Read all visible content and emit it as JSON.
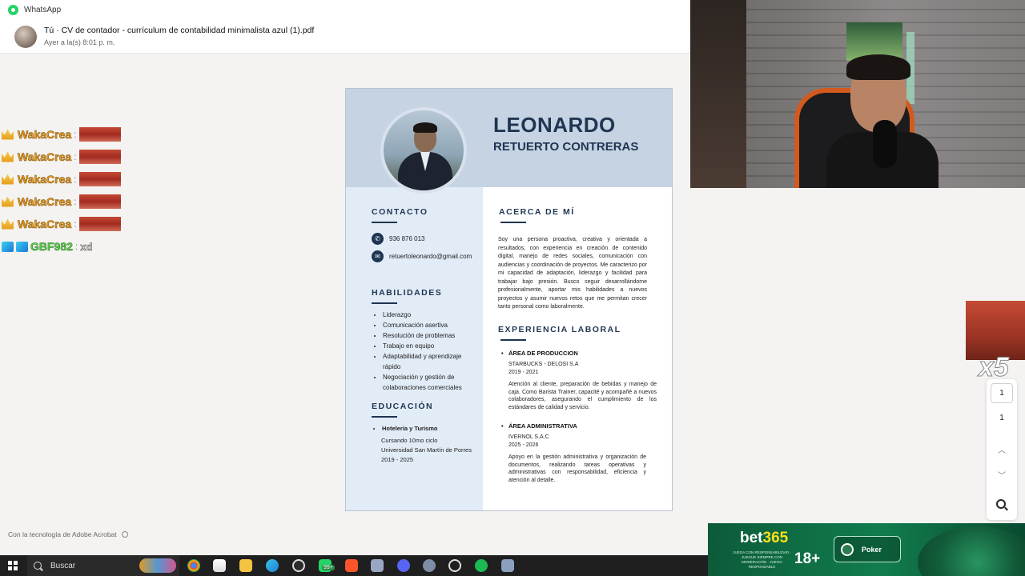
{
  "whatsapp": {
    "app_name": "WhatsApp",
    "file_title": "Tú · CV de contador - currículum de contabilidad minimalista azul (1).pdf",
    "file_time": "Ayer a la(s) 8:01 p. m."
  },
  "chat": [
    {
      "user": "WakaCrea",
      "sep": ":"
    },
    {
      "user": "WakaCrea",
      "sep": ":"
    },
    {
      "user": "WakaCrea",
      "sep": ":"
    },
    {
      "user": "WakaCrea",
      "sep": ":"
    },
    {
      "user": "WakaCrea",
      "sep": ":"
    },
    {
      "user": "GBF982",
      "sep": ":",
      "message": "xd"
    }
  ],
  "cv": {
    "first_name": "LEONARDO",
    "last_name": "RETUERTO CONTRERAS",
    "contact_heading": "CONTACTO",
    "phone": "936 876 013",
    "email": "retuertoleonardo@gmail.com",
    "skills_heading": "HABILIDADES",
    "skills": [
      "Liderazgo",
      "Comunicación asertiva",
      "Resolución de problemas",
      "Trabajo en equipo",
      "Adaptabilidad y aprendizaje rápido",
      "Negociación y gestión de colaboraciones comerciales"
    ],
    "education_heading": "EDUCACIÓN",
    "education": {
      "title": "Hotelería y Turismo",
      "line1": "Cursando 10mo ciclo",
      "line2": "Universidad San Martín de Porres",
      "line3": "2019 - 2025"
    },
    "about_heading": "ACERCA DE MÍ",
    "about_text": "Soy una persona proactiva, creativa y orientada a resultados, con experiencia en creación de contenido digital, manejo de redes sociales, comunicación con audiencias y coordinación de proyectos. Me caracterizo por mi capacidad de adaptación, liderazgo y facilidad para trabajar bajo presión. Busco seguir desarrollándome profesionalmente, aportar mis habilidades a nuevos proyectos y asumir nuevos retos que me permitan crecer tanto personal como laboralmente.",
    "experience_heading": "EXPERIENCIA LABORAL",
    "jobs": [
      {
        "title": "ÁREA DE PRODUCCION",
        "company": "STARBUCKS - DELOSI S.A",
        "years": "2019 - 2021",
        "desc": "Atención al cliente, preparación de bebidas y manejo de caja. Como Barista Trainer, capacité y acompañé a nuevos colaboradores, asegurando el cumplimiento de los estándares de calidad y servicio."
      },
      {
        "title": "ÁREA ADMINISTRATIVA",
        "company": "IVERNOL S.A.C",
        "years": "2025 - 2026",
        "desc": "Apoyo en la gestión administrativa y organización de documentos, realizando tareas operativas y administrativas con responsabilidad, eficiencia y atención al detalle."
      }
    ]
  },
  "viewer": {
    "powered_by": "Con la tecnología de Adobe Acrobat",
    "current_page": "1",
    "total_pages": "1"
  },
  "overlay": {
    "multiplier": "x5"
  },
  "ad": {
    "brand_left": "bet",
    "brand_right": "365",
    "small_text": "JUEGA CON RESPONSABILIDAD · JUEGUE SIEMPRE CON MODERACIÓN · JUEGO RESPONSABLE",
    "age": "18+",
    "button": "Poker"
  },
  "taskbar": {
    "search_label": "Buscar",
    "badge": "99+",
    "icons": [
      "chrome-icon",
      "store-icon",
      "explorer-icon",
      "edge-icon",
      "obs-icon",
      "whatsapp-icon",
      "brave-icon",
      "app-icon",
      "discord-icon",
      "app2-icon",
      "steam-icon",
      "spotify-icon",
      "calculator-icon"
    ]
  }
}
